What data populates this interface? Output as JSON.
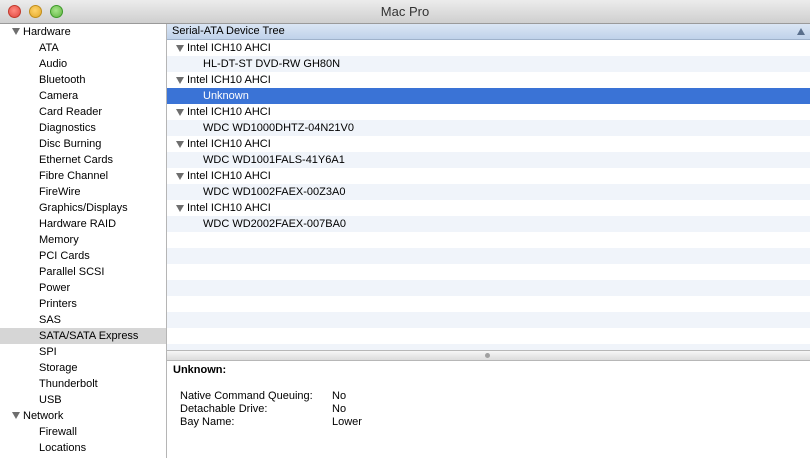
{
  "window": {
    "title": "Mac Pro"
  },
  "sidebar": {
    "sections": [
      {
        "label": "Hardware",
        "items": [
          "ATA",
          "Audio",
          "Bluetooth",
          "Camera",
          "Card Reader",
          "Diagnostics",
          "Disc Burning",
          "Ethernet Cards",
          "Fibre Channel",
          "FireWire",
          "Graphics/Displays",
          "Hardware RAID",
          "Memory",
          "PCI Cards",
          "Parallel SCSI",
          "Power",
          "Printers",
          "SAS",
          "SATA/SATA Express",
          "SPI",
          "Storage",
          "Thunderbolt",
          "USB"
        ]
      },
      {
        "label": "Network",
        "items": [
          "Firewall",
          "Locations"
        ]
      }
    ],
    "selected": "SATA/SATA Express"
  },
  "table": {
    "header": "Serial-ATA Device Tree",
    "rows": [
      {
        "label": "Intel ICH10 AHCI",
        "level": 0
      },
      {
        "label": "HL-DT-ST DVD-RW GH80N",
        "level": 1
      },
      {
        "label": "Intel ICH10 AHCI",
        "level": 0
      },
      {
        "label": "Unknown",
        "level": 1,
        "selected": true
      },
      {
        "label": "Intel ICH10 AHCI",
        "level": 0
      },
      {
        "label": "WDC WD1000DHTZ-04N21V0",
        "level": 1
      },
      {
        "label": "Intel ICH10 AHCI",
        "level": 0
      },
      {
        "label": "WDC WD1001FALS-41Y6A1",
        "level": 1
      },
      {
        "label": "Intel ICH10 AHCI",
        "level": 0
      },
      {
        "label": "WDC WD1002FAEX-00Z3A0",
        "level": 1
      },
      {
        "label": "Intel ICH10 AHCI",
        "level": 0
      },
      {
        "label": "WDC WD2002FAEX-007BA0",
        "level": 1
      }
    ]
  },
  "detail": {
    "title": "Unknown:",
    "properties": [
      {
        "label": "Native Command Queuing:",
        "value": "No"
      },
      {
        "label": "Detachable Drive:",
        "value": "No"
      },
      {
        "label": "Bay Name:",
        "value": "Lower"
      }
    ]
  },
  "colors": {
    "selection": "#3a73d6",
    "header": "#c9d9ee",
    "alt_row": "#f0f4fa",
    "sidebar_selected": "#d6d6d6"
  }
}
